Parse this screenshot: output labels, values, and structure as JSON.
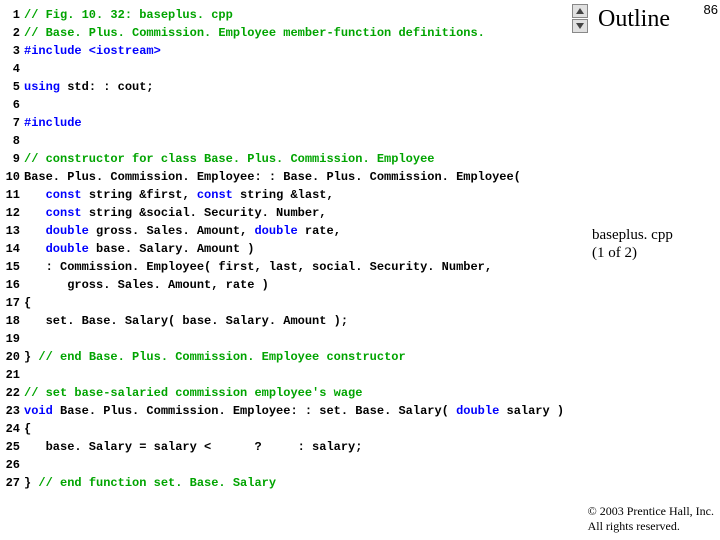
{
  "side": {
    "outline": "Outline",
    "slide_number": "86",
    "file_line1": "baseplus. cpp",
    "file_line2": "(1 of 2)",
    "copyright_line1": "© 2003 Prentice Hall, Inc.",
    "copyright_line2": "All rights reserved."
  },
  "code": {
    "lines": [
      {
        "n": "1",
        "spans": [
          {
            "cls": "c-comment",
            "t": "// Fig. 10. 32: baseplus. cpp"
          }
        ]
      },
      {
        "n": "2",
        "spans": [
          {
            "cls": "c-comment",
            "t": "// Base. Plus. Commission. Employee member-function definitions."
          }
        ]
      },
      {
        "n": "3",
        "spans": [
          {
            "cls": "c-preproc",
            "t": "#include <iostream>"
          }
        ]
      },
      {
        "n": "4",
        "spans": [
          {
            "cls": "c-normal",
            "t": ""
          }
        ]
      },
      {
        "n": "5",
        "spans": [
          {
            "cls": "c-keyword",
            "t": "using"
          },
          {
            "cls": "c-normal",
            "t": " std: : cout;"
          }
        ]
      },
      {
        "n": "6",
        "spans": [
          {
            "cls": "c-normal",
            "t": ""
          }
        ]
      },
      {
        "n": "7",
        "spans": [
          {
            "cls": "c-preproc",
            "t": "#include"
          }
        ]
      },
      {
        "n": "8",
        "spans": [
          {
            "cls": "c-normal",
            "t": ""
          }
        ]
      },
      {
        "n": "9",
        "spans": [
          {
            "cls": "c-comment",
            "t": "// constructor for class Base. Plus. Commission. Employee"
          }
        ]
      },
      {
        "n": "10",
        "spans": [
          {
            "cls": "c-normal",
            "t": "Base. Plus. Commission. Employee: : Base. Plus. Commission. Employee("
          }
        ]
      },
      {
        "n": "11",
        "spans": [
          {
            "cls": "c-normal",
            "t": "   "
          },
          {
            "cls": "c-keyword",
            "t": "const"
          },
          {
            "cls": "c-normal",
            "t": " string &first, "
          },
          {
            "cls": "c-keyword",
            "t": "const"
          },
          {
            "cls": "c-normal",
            "t": " string &last,"
          }
        ]
      },
      {
        "n": "12",
        "spans": [
          {
            "cls": "c-normal",
            "t": "   "
          },
          {
            "cls": "c-keyword",
            "t": "const"
          },
          {
            "cls": "c-normal",
            "t": " string &social. Security. Number,"
          }
        ]
      },
      {
        "n": "13",
        "spans": [
          {
            "cls": "c-normal",
            "t": "   "
          },
          {
            "cls": "c-keyword",
            "t": "double"
          },
          {
            "cls": "c-normal",
            "t": " gross. Sales. Amount, "
          },
          {
            "cls": "c-keyword",
            "t": "double"
          },
          {
            "cls": "c-normal",
            "t": " rate,"
          }
        ]
      },
      {
        "n": "14",
        "spans": [
          {
            "cls": "c-normal",
            "t": "   "
          },
          {
            "cls": "c-keyword",
            "t": "double"
          },
          {
            "cls": "c-normal",
            "t": " base. Salary. Amount )"
          }
        ]
      },
      {
        "n": "15",
        "spans": [
          {
            "cls": "c-normal",
            "t": "   : Commission. Employee( first, last, social. Security. Number,"
          }
        ]
      },
      {
        "n": "16",
        "spans": [
          {
            "cls": "c-normal",
            "t": "      gross. Sales. Amount, rate )"
          }
        ]
      },
      {
        "n": "17",
        "spans": [
          {
            "cls": "c-normal",
            "t": "{"
          }
        ]
      },
      {
        "n": "18",
        "spans": [
          {
            "cls": "c-normal",
            "t": "   set. Base. Salary( base. Salary. Amount );"
          }
        ]
      },
      {
        "n": "19",
        "spans": [
          {
            "cls": "c-normal",
            "t": ""
          }
        ]
      },
      {
        "n": "20",
        "spans": [
          {
            "cls": "c-normal",
            "t": "} "
          },
          {
            "cls": "c-comment",
            "t": "// end Base. Plus. Commission. Employee constructor"
          }
        ]
      },
      {
        "n": "21",
        "spans": [
          {
            "cls": "c-normal",
            "t": ""
          }
        ]
      },
      {
        "n": "22",
        "spans": [
          {
            "cls": "c-comment",
            "t": "// set base-salaried commission employee's wage"
          }
        ]
      },
      {
        "n": "23",
        "spans": [
          {
            "cls": "c-keyword",
            "t": "void"
          },
          {
            "cls": "c-normal",
            "t": " Base. Plus. Commission. Employee: : set. Base. Salary( "
          },
          {
            "cls": "c-keyword",
            "t": "double"
          },
          {
            "cls": "c-normal",
            "t": " salary )"
          }
        ]
      },
      {
        "n": "24",
        "spans": [
          {
            "cls": "c-normal",
            "t": "{"
          }
        ]
      },
      {
        "n": "25",
        "spans": [
          {
            "cls": "c-normal",
            "t": "   base. Salary = salary <      ?     : salary;"
          }
        ]
      },
      {
        "n": "26",
        "spans": [
          {
            "cls": "c-normal",
            "t": ""
          }
        ]
      },
      {
        "n": "27",
        "spans": [
          {
            "cls": "c-normal",
            "t": "} "
          },
          {
            "cls": "c-comment",
            "t": "// end function set. Base. Salary"
          }
        ]
      }
    ]
  }
}
